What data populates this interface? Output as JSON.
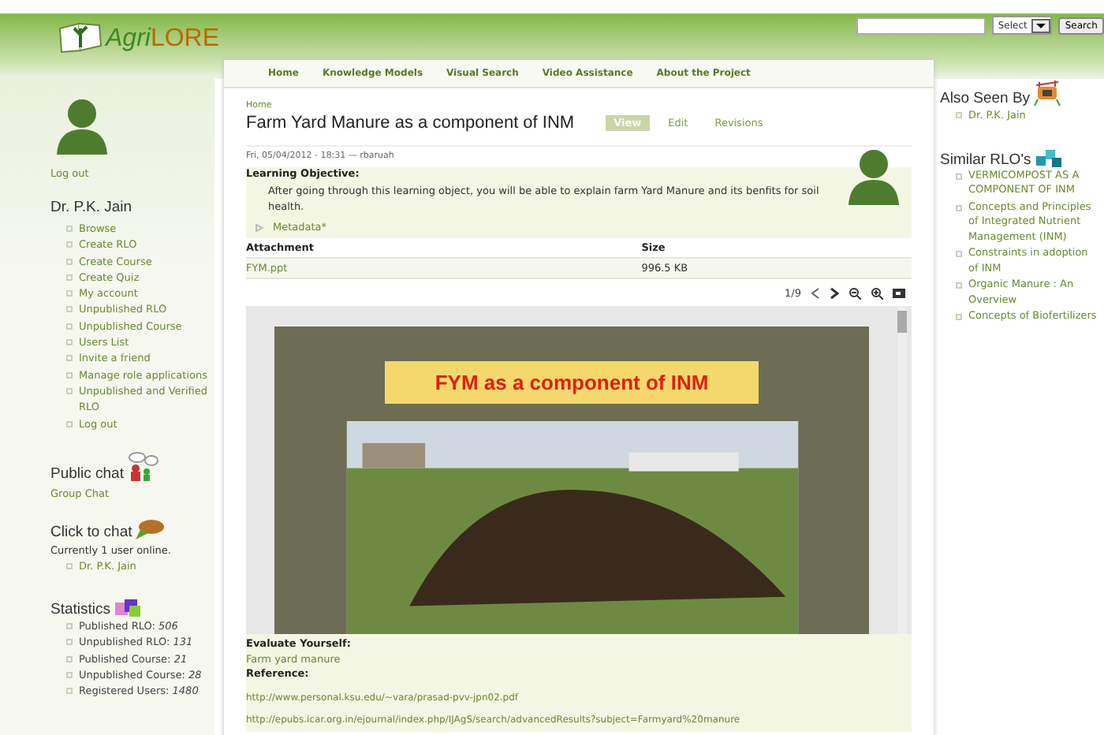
{
  "header": {
    "logo_text": "LORE",
    "logo_prefix": "Agri",
    "select": "Select",
    "search_button": "Search"
  },
  "nav": [
    "Home",
    "Knowledge Models",
    "Visual Search",
    "Video Assistance",
    "About the Project"
  ],
  "sidebar_left": {
    "logout": "Log out",
    "user": "Dr. P.K. Jain",
    "menu": [
      "Browse",
      "Create RLO",
      "Create Course",
      "Create Quiz",
      "My account",
      "Unpublished RLO",
      "Unpublished Course",
      "Users List",
      "Invite a friend",
      "Manage role applications",
      "Unpublished and Verified RLO",
      "Log out"
    ],
    "public_chat": {
      "title": "Public chat",
      "link": "Group Chat"
    },
    "click_chat": {
      "title": "Click to chat",
      "status": "Currently 1 user online.",
      "users": [
        "Dr. P.K. Jain"
      ]
    },
    "statistics": {
      "title": "Statistics",
      "items": [
        {
          "label": "Published RLO:",
          "value": "506"
        },
        {
          "label": "Unpublished RLO:",
          "value": "131"
        },
        {
          "label": "Published Course:",
          "value": "21"
        },
        {
          "label": "Unpublished Course:",
          "value": "28"
        },
        {
          "label": "Registered Users:",
          "value": "1480"
        }
      ]
    }
  },
  "main": {
    "breadcrumb": "Home",
    "title": "Farm Yard Manure as a component of INM",
    "tabs": [
      {
        "label": "View",
        "selected": true
      },
      {
        "label": "Edit",
        "selected": false
      },
      {
        "label": "Revisions",
        "selected": false
      }
    ],
    "submitted": "Fri, 05/04/2012 - 18:31 — rbaruah",
    "objective_label": "Learning Objective:",
    "objective": "After going through this learning object, you will be able to explain farm Yard Manure and its benfits for soil health.",
    "metadata": {
      "label": "Metadata*",
      "expanded": false
    },
    "attachments": {
      "columns": [
        "Attachment",
        "Size"
      ],
      "rows": [
        [
          "FYM.ppt",
          "996.5 KB"
        ]
      ]
    },
    "viewer": {
      "page": "1/9",
      "slide_title": "FYM as a component of  INM"
    },
    "evaluate_label": "Evaluate Yourself:",
    "evaluate_link": "Farm yard manure",
    "reference_label": "Reference:",
    "references": [
      "http://www.personal.ksu.edu/~vara/prasad-pvv-jpn02.pdf",
      "http://epubs.icar.org.in/ejournal/index.php/IJAgS/search/advancedResults?subject=Farmyard%20manure"
    ]
  },
  "sidebar_right": {
    "also_seen": {
      "title": "Also Seen By",
      "items": [
        "Dr. P.K. Jain"
      ]
    },
    "similar": {
      "title": "Similar RLO's",
      "items": [
        "VERMICOMPOST AS A COMPONENT OF INM",
        "Concepts and Principles of Integrated Nutrient Management (INM)",
        "Constraints in adoption of INM",
        "Organic Manure : An Overview",
        "Concepts of Biofertilizers"
      ]
    }
  }
}
